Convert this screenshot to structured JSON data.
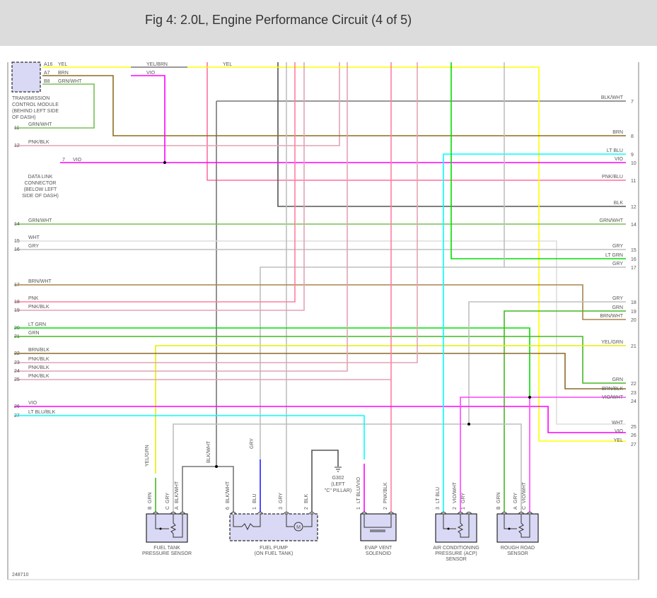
{
  "header": {
    "title": "Fig 4: 2.0L, Engine Performance Circuit (4 of 5)"
  },
  "tcm": {
    "pins": [
      {
        "pin": "A16",
        "wire": "YEL"
      },
      {
        "pin": "A7",
        "wire": "BRN"
      },
      {
        "pin": "B8",
        "wire": "GRN/WHT"
      }
    ],
    "label": [
      "TRANSMISSION",
      "CONTROL MODULE",
      "(BEHIND LEFT SIDE",
      "OF DASH)"
    ]
  },
  "top_labels": {
    "yel_brn": "YEL/BRN",
    "vio": "VIO",
    "yel": "YEL"
  },
  "dlc": {
    "pin": "7",
    "wire": "VIO",
    "label": [
      "DATA LINK",
      "CONNECTOR",
      "(BELOW LEFT",
      "SIDE OF DASH)"
    ]
  },
  "left_rows": [
    {
      "num": "11",
      "wire": "GRN/WHT"
    },
    {
      "num": "12",
      "wire": "PNK/BLK"
    },
    {
      "num": "14",
      "wire": "GRN/WHT"
    },
    {
      "num": "15",
      "wire": "WHT"
    },
    {
      "num": "16",
      "wire": "GRY"
    },
    {
      "num": "17",
      "wire": "BRN/WHT"
    },
    {
      "num": "18",
      "wire": "PNK"
    },
    {
      "num": "19",
      "wire": "PNK/BLK"
    },
    {
      "num": "20",
      "wire": "LT GRN"
    },
    {
      "num": "21",
      "wire": "GRN"
    },
    {
      "num": "22",
      "wire": "BRN/BLK"
    },
    {
      "num": "23",
      "wire": "PNK/BLK"
    },
    {
      "num": "24",
      "wire": "PNK/BLK"
    },
    {
      "num": "25",
      "wire": "PNK/BLK"
    },
    {
      "num": "26",
      "wire": "VIO"
    },
    {
      "num": "27",
      "wire": "LT BLU/BLK"
    }
  ],
  "right_rows": [
    {
      "num": "7",
      "wire": "BLK/WHT"
    },
    {
      "num": "8",
      "wire": "BRN"
    },
    {
      "num": "9",
      "wire": "LT BLU"
    },
    {
      "num": "10",
      "wire": "VIO"
    },
    {
      "num": "11",
      "wire": "PNK/BLU"
    },
    {
      "num": "12",
      "wire": "BLK"
    },
    {
      "num": "14",
      "wire": "GRN/WHT"
    },
    {
      "num": "15",
      "wire": "GRY"
    },
    {
      "num": "16",
      "wire": "LT GRN"
    },
    {
      "num": "17",
      "wire": "GRY"
    },
    {
      "num": "18",
      "wire": "GRY"
    },
    {
      "num": "19",
      "wire": "GRN"
    },
    {
      "num": "20",
      "wire": "BRN/WHT"
    },
    {
      "num": "21",
      "wire": "YEL/GRN"
    },
    {
      "num": "22",
      "wire": "GRN"
    },
    {
      "num": "23",
      "wire": "BRN/BLK"
    },
    {
      "num": "24",
      "wire": "VIO/WHT"
    },
    {
      "num": "25",
      "wire": "WHT"
    },
    {
      "num": "26",
      "wire": "VIO"
    },
    {
      "num": "27",
      "wire": "YEL"
    }
  ],
  "mid_labels": {
    "yel_grn": "YEL/GRN",
    "blk_wht": "BLK/WHT",
    "gry": "GRY"
  },
  "ground": {
    "label": [
      "G302",
      "(LEFT",
      "\"C\" PILLAR)"
    ]
  },
  "components": [
    {
      "id": "fuel-tank-pressure-sensor",
      "label": [
        "FUEL TANK",
        "PRESSURE SENSOR"
      ],
      "pins": [
        {
          "pin": "B",
          "wire": "GRN"
        },
        {
          "pin": "C",
          "wire": "GRY"
        },
        {
          "pin": "A",
          "wire": "BLK/WHT"
        }
      ]
    },
    {
      "id": "fuel-pump",
      "label": [
        "FUEL PUMP",
        "(ON FUEL TANK)"
      ],
      "pins": [
        {
          "pin": "6",
          "wire": "BLK/WHT"
        },
        {
          "pin": "1",
          "wire": "BLU"
        },
        {
          "pin": "3",
          "wire": "GRY"
        },
        {
          "pin": "2",
          "wire": "BLK"
        }
      ],
      "motor": "M"
    },
    {
      "id": "evap-vent-solenoid",
      "label": [
        "EVAP VENT",
        "SOLENOID"
      ],
      "pins": [
        {
          "pin": "1",
          "wire": "LT BLU/VIO"
        },
        {
          "pin": "2",
          "wire": "PNK/BLK"
        }
      ]
    },
    {
      "id": "acp-sensor",
      "label": [
        "AIR CONDITIONING",
        "PRESSURE (ACP)",
        "SENSOR"
      ],
      "pins": [
        {
          "pin": "3",
          "wire": "LT BLU"
        },
        {
          "pin": "2",
          "wire": "VIO/WHT"
        },
        {
          "pin": "1",
          "wire": "GRY"
        }
      ]
    },
    {
      "id": "rough-road-sensor",
      "label": [
        "ROUGH ROAD",
        "SENSOR"
      ],
      "pins": [
        {
          "pin": "B",
          "wire": "GRN"
        },
        {
          "pin": "A",
          "wire": "GRY"
        },
        {
          "pin": "C",
          "wire": "VIO/WHT"
        }
      ]
    }
  ],
  "figure_number": "248710",
  "colors": {
    "YEL": "#ffff00",
    "BRN": "#8c6d1f",
    "GRN/WHT": "#77c055",
    "VIO": "#ff00ff",
    "PNK/BLU": "#ff6f9f",
    "BLK/WHT": "#777777",
    "BLK": "#555555",
    "PNK/BLK": "#e2a3b3",
    "GRY": "#bfbfbf",
    "WHT": "#dddddd",
    "LT GRN": "#00dd00",
    "GRN": "#44b822",
    "LT BLU": "#00ffff",
    "BRN/WHT": "#a8844c",
    "BRN/BLK": "#8a6a2a",
    "YEL/GRN": "#e4f000",
    "BLU": "#2020ff",
    "PNK": "#ff7fa0",
    "VIO/WHT": "#ff44ff",
    "component": "#d9d9f5"
  }
}
